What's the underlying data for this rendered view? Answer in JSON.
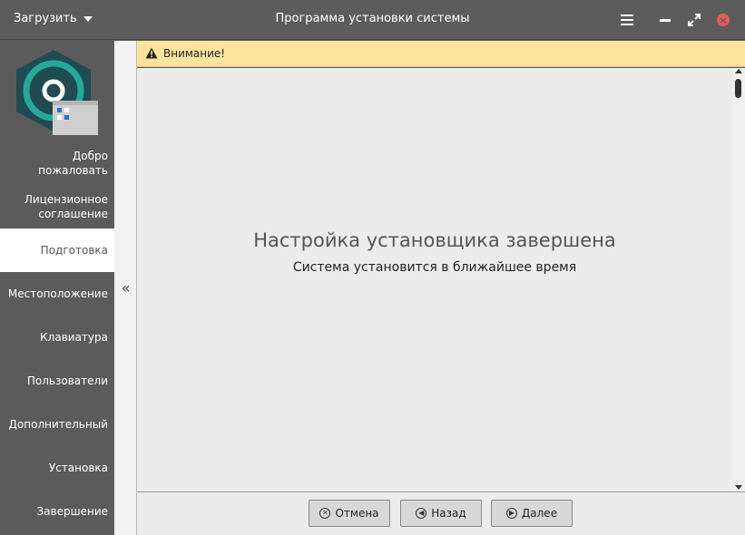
{
  "window": {
    "title": "Программа установки системы",
    "menu_label": "Загрузить"
  },
  "icons": {
    "menu": "hamburger-icon",
    "minimize": "minimize-icon",
    "maximize": "maximize-icon",
    "close": "close-icon",
    "warning": "warning-icon",
    "collapse": "double-chevron-left-icon",
    "cancel": "cancel-circle-icon",
    "back": "arrow-left-circle-icon",
    "next": "arrow-right-circle-icon"
  },
  "colors": {
    "sidebar_bg": "#5b5b5b",
    "warning_bg": "#fde49c",
    "close_red": "#e45b5b",
    "logo_teal": "#24a99a"
  },
  "sidebar": {
    "steps": [
      {
        "label": "Добро пожаловать"
      },
      {
        "label": "Лицензионное соглашение"
      },
      {
        "label": "Подготовка",
        "active": true
      },
      {
        "label": "Местоположение"
      },
      {
        "label": "Клавиатура"
      },
      {
        "label": "Пользователи"
      },
      {
        "label": "Дополнительный"
      },
      {
        "label": "Установка"
      },
      {
        "label": "Завершение"
      }
    ]
  },
  "collapse_symbol": "«",
  "warning": {
    "text": "Внимание!"
  },
  "main": {
    "heading": "Настройка установщика завершена",
    "subheading": "Система установится в ближайшее время"
  },
  "footer": {
    "cancel_label": "Отмена",
    "back_label": "Назад",
    "next_label": "Далее"
  }
}
